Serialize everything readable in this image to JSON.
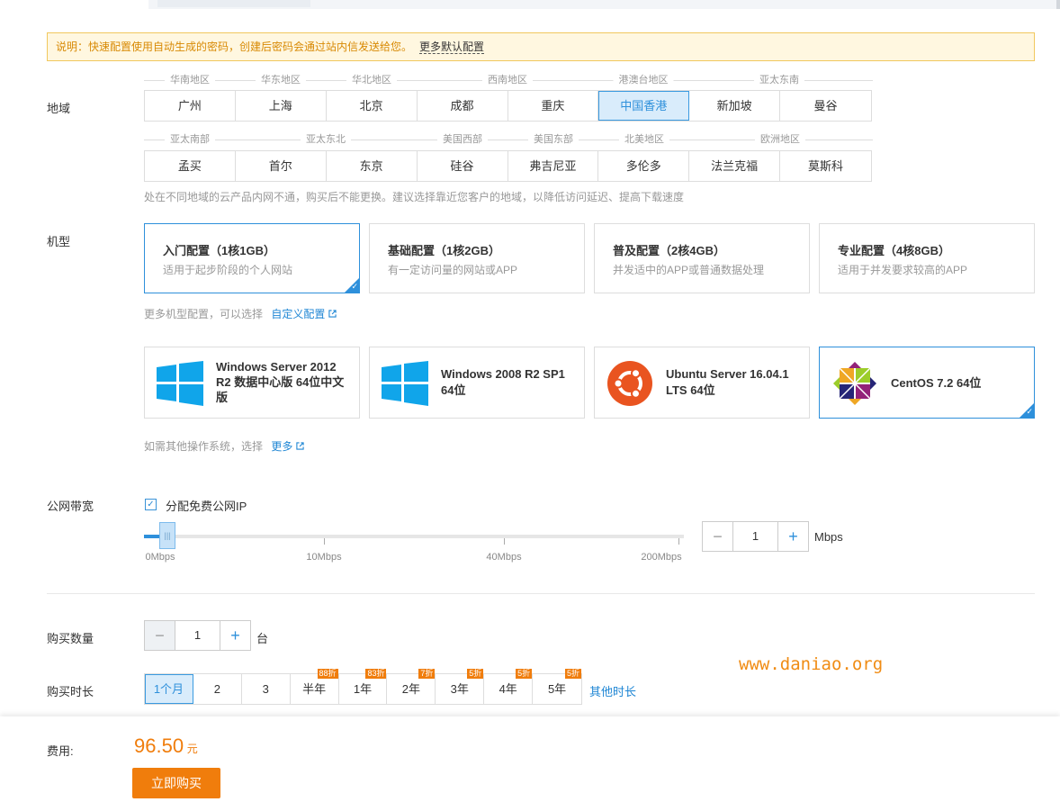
{
  "notice": {
    "text": "说明：快速配置使用自动生成的密码，创建后密码会通过站内信发送给您。",
    "more": "更多默认配置"
  },
  "region": {
    "label": "地域",
    "groups_row1": [
      "华南地区",
      "华东地区",
      "华北地区",
      "西南地区",
      "港澳台地区",
      "亚太东南"
    ],
    "cells_row1": [
      "广州",
      "上海",
      "北京",
      "成都",
      "重庆",
      "中国香港",
      "新加坡",
      "曼谷"
    ],
    "groups_row2": [
      "亚太南部",
      "亚太东北",
      "美国西部",
      "美国东部",
      "北美地区",
      "欧洲地区"
    ],
    "cells_row2": [
      "孟买",
      "首尔",
      "东京",
      "硅谷",
      "弗吉尼亚",
      "多伦多",
      "法兰克福",
      "莫斯科"
    ],
    "selected": "中国香港",
    "hint": "处在不同地域的云产品内网不通，购买后不能更换。建议选择靠近您客户的地域，以降低访问延迟、提高下载速度"
  },
  "machine": {
    "label": "机型",
    "cards": [
      {
        "title": "入门配置（1核1GB）",
        "desc": "适用于起步阶段的个人网站"
      },
      {
        "title": "基础配置（1核2GB）",
        "desc": "有一定访问量的网站或APP"
      },
      {
        "title": "普及配置（2核4GB）",
        "desc": "并发适中的APP或普通数据处理"
      },
      {
        "title": "专业配置（4核8GB）",
        "desc": "适用于并发要求较高的APP"
      }
    ],
    "hint": "更多机型配置，可以选择",
    "custom_link": "自定义配置"
  },
  "os": {
    "items": [
      {
        "l1": "Windows Server 2012",
        "l2": "R2 数据中心版 64位中文",
        "l3": "版"
      },
      {
        "l1": "Windows 2008 R2 SP1",
        "l2": "64位"
      },
      {
        "l1": "Ubuntu Server 16.04.1",
        "l2": "LTS 64位"
      },
      {
        "l1": "CentOS 7.2 64位"
      }
    ],
    "hint": "如需其他操作系统，选择",
    "more_link": "更多"
  },
  "bandwidth": {
    "label": "公网带宽",
    "checkbox": "分配免费公网IP",
    "checked": true,
    "ticks": [
      "0Mbps",
      "10Mbps",
      "40Mbps",
      "200Mbps"
    ],
    "value": "1",
    "unit": "Mbps",
    "handle_glyph": "|||"
  },
  "quantity": {
    "label": "购买数量",
    "value": "1",
    "unit": "台"
  },
  "duration": {
    "label": "购买时长",
    "options": [
      {
        "label": "1个月",
        "badge": ""
      },
      {
        "label": "2",
        "badge": ""
      },
      {
        "label": "3",
        "badge": ""
      },
      {
        "label": "半年",
        "badge": "88折"
      },
      {
        "label": "1年",
        "badge": "83折"
      },
      {
        "label": "2年",
        "badge": "7折"
      },
      {
        "label": "3年",
        "badge": "5折"
      },
      {
        "label": "4年",
        "badge": "5折"
      },
      {
        "label": "5年",
        "badge": "5折"
      }
    ],
    "selected": "1个月",
    "other_link": "其他时长"
  },
  "footer": {
    "fee_label": "费用:",
    "price": "96.50",
    "unit": "元",
    "buy": "立即购买"
  },
  "watermark": "www.daniao.org",
  "glyphs": {
    "minus": "−",
    "plus": "+",
    "check": "✓"
  },
  "colors": {
    "accent": "#2e90db",
    "orange": "#f07d0c",
    "selected_bg": "#d9ecfb"
  }
}
